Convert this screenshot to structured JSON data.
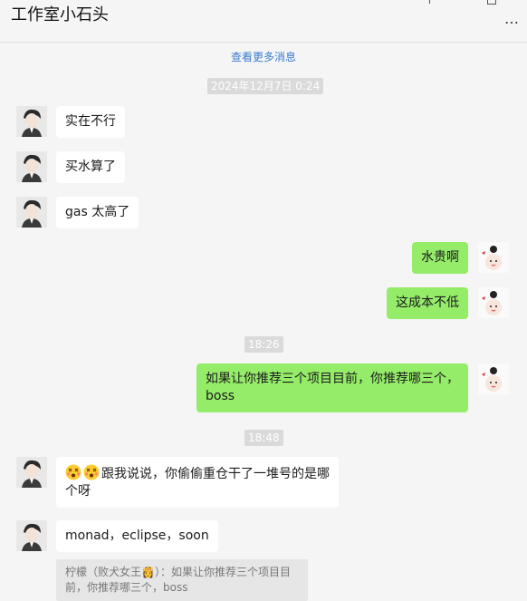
{
  "header": {
    "title": "工作室小石头",
    "more_label": "…"
  },
  "load_more": "查看更多消息",
  "timestamps": [
    "2024年12月7日 0:24",
    "18:26",
    "18:48"
  ],
  "messages": [
    {
      "side": "left",
      "text": "实在不行"
    },
    {
      "side": "left",
      "text": "买水算了"
    },
    {
      "side": "left",
      "text": "gas 太高了"
    },
    {
      "side": "right",
      "text": "水贵啊"
    },
    {
      "side": "right",
      "text": "这成本不低"
    },
    {
      "side": "right",
      "text": "如果让你推荐三个项目目前，你推荐哪三个，boss"
    },
    {
      "side": "left",
      "text": "跟我说说，你偷偷重仓干了一堆号的是哪个呀",
      "emojis": [
        "dizzy-face-icon",
        "dizzy-face-icon"
      ]
    },
    {
      "side": "left",
      "text": "monad，eclipse，soon"
    }
  ],
  "quote": {
    "text": "柠檬（败犬女王👸）：如果让你推荐三个项目目前，你推荐哪三个，boss"
  },
  "colors": {
    "background": "#f5f5f5",
    "bubble_self": "#95ec69",
    "bubble_other": "#ffffff",
    "link": "#3c7bd0"
  }
}
